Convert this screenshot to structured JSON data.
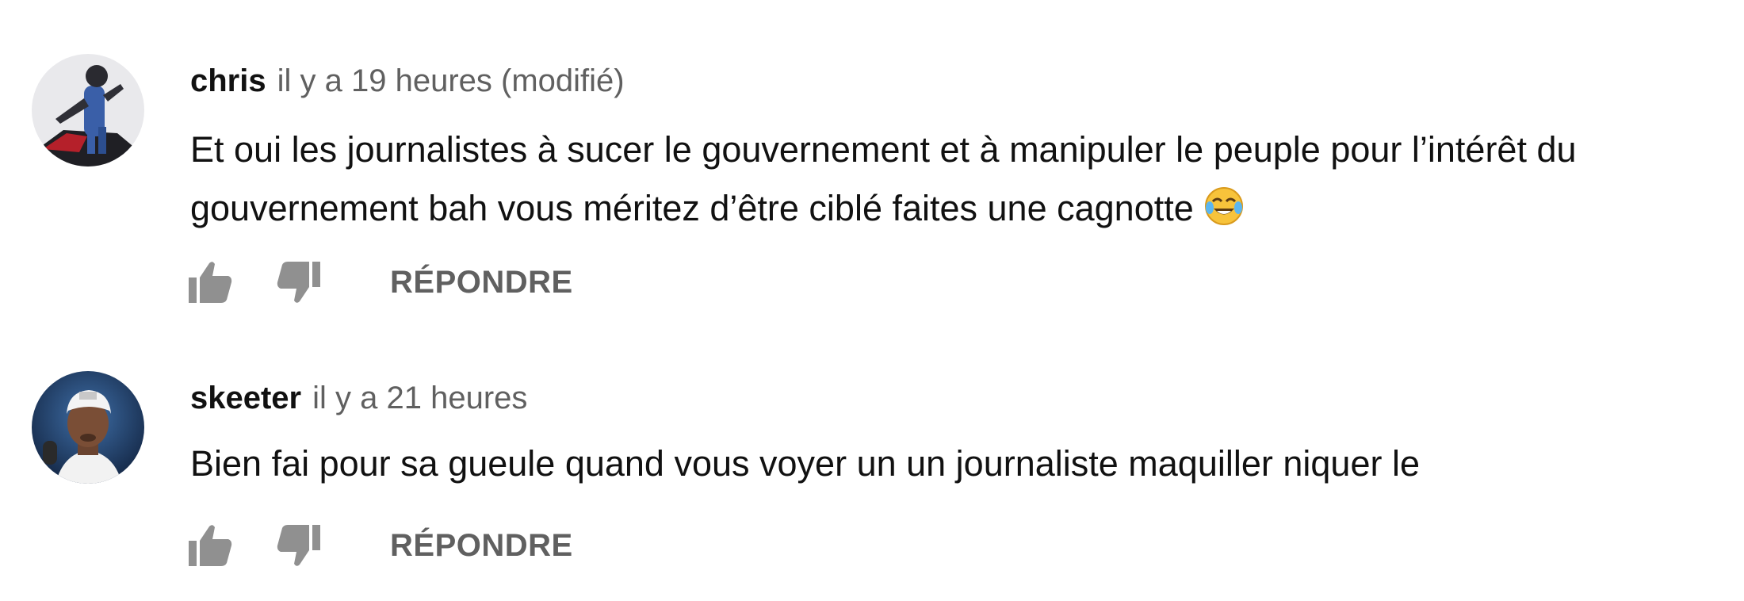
{
  "comments": [
    {
      "author": "chris",
      "time": "il y a 19 heures (modifié)",
      "text": "Et oui les journalistes à sucer le gouvernement et à manipuler le peuple pour l’intérêt du gouvernement bah vous méritez  d’être ciblé faites une cagnotte",
      "emoji": "face-with-tears-of-joy",
      "reply_label": "RÉPONDRE"
    },
    {
      "author": "skeeter",
      "time": "il y a 21 heures",
      "text": "Bien fai pour sa gueule quand vous voyer un un journaliste maquiller niquer le",
      "reply_label": "RÉPONDRE"
    }
  ],
  "icons": {
    "like": "thumb-up-icon",
    "dislike": "thumb-down-icon"
  },
  "colors": {
    "icon": "#909090",
    "secondary_text": "#606060",
    "primary_text": "#111111"
  }
}
